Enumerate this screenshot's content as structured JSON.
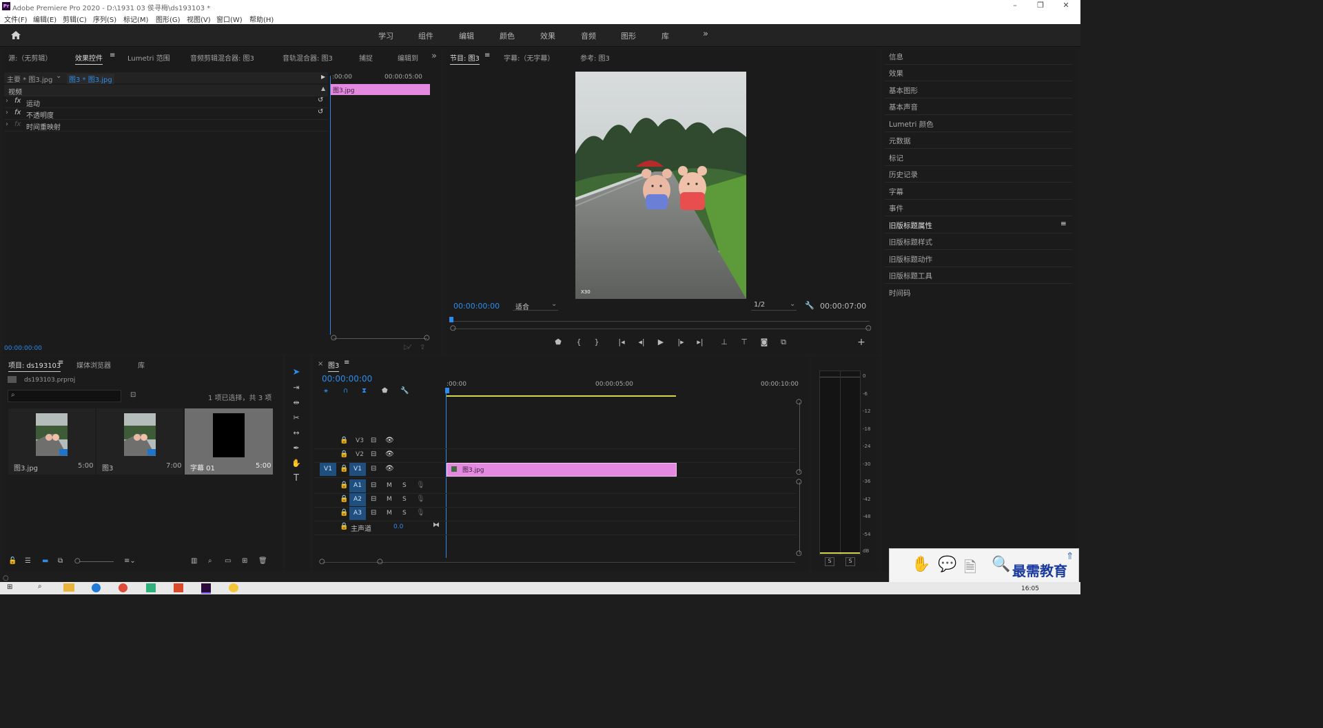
{
  "window": {
    "title": "Adobe Premiere Pro 2020 - D:\\1931 03 侯寻梅\\ds193103 *",
    "logo": "Pr"
  },
  "menu": [
    "文件(F)",
    "编辑(E)",
    "剪辑(C)",
    "序列(S)",
    "标记(M)",
    "图形(G)",
    "视图(V)",
    "窗口(W)",
    "帮助(H)"
  ],
  "workspaces": [
    "学习",
    "组件",
    "编辑",
    "颜色",
    "效果",
    "音频",
    "图形",
    "库"
  ],
  "source_panel": {
    "tabs": [
      "源:（无剪辑）",
      "效果控件",
      "Lumetri 范围",
      "音频剪辑混合器: 图3",
      "音轨混合器: 图3",
      "捕捉",
      "编辑到"
    ],
    "master": "主要 * 图3.jpg",
    "clip": "图3 * 图3.jpg",
    "ruler_start": ":00:00",
    "ruler_mid": "00:00:05:00",
    "clip_bar": "图3.jpg",
    "section_video": "视频",
    "effects": [
      "运动",
      "不透明度",
      "时间重映射"
    ],
    "timecode": "00:00:00:00"
  },
  "program_panel": {
    "tabs": [
      "节目: 图3",
      "字幕:（无字幕）",
      "参考: 图3"
    ],
    "timecode": "00:00:00:00",
    "fit": "适合",
    "resolution": "1/2",
    "duration": "00:00:07:00",
    "watermark": "X30"
  },
  "right_panel": {
    "items": [
      "信息",
      "效果",
      "基本图形",
      "基本声音",
      "Lumetri 颜色",
      "元数据",
      "标记",
      "历史记录",
      "字幕",
      "事件",
      "旧版标题属性",
      "旧版标题样式",
      "旧版标题动作",
      "旧版标题工具",
      "时间码"
    ]
  },
  "project_panel": {
    "tabs": [
      "项目: ds193103",
      "媒体浏览器",
      "库"
    ],
    "file": "ds193103.prproj",
    "selection": "1 项已选择，共 3 项",
    "items": [
      {
        "name": "图3.jpg",
        "duration": "5:00"
      },
      {
        "name": "图3",
        "duration": "7:00"
      },
      {
        "name": "字幕 01",
        "duration": "5:00"
      }
    ]
  },
  "timeline": {
    "tab": "图3",
    "timecode": "00:00:00:00",
    "ruler": [
      ":00:00",
      "00:00:05:00",
      "00:00:10:00"
    ],
    "video_tracks": [
      "V3",
      "V2",
      "V1"
    ],
    "source_patch": "V1",
    "audio_tracks": [
      "A1",
      "A2",
      "A3"
    ],
    "master": "主声道",
    "master_value": "0.0",
    "clip": "图3.jpg",
    "track_m": "M",
    "track_s": "S"
  },
  "meter": {
    "scale": [
      "0",
      "-6",
      "-12",
      "-18",
      "-24",
      "-30",
      "-36",
      "-42",
      "-48",
      "-54",
      "dB"
    ],
    "solo": [
      "S",
      "S"
    ]
  },
  "overlay": {
    "brand": "最需教育"
  },
  "taskbar": {
    "time": "16:05"
  },
  "colors": {
    "accent_blue": "#2d8ceb",
    "clip_pink": "#e38ae0",
    "panel_bg": "#1b1b1b"
  }
}
